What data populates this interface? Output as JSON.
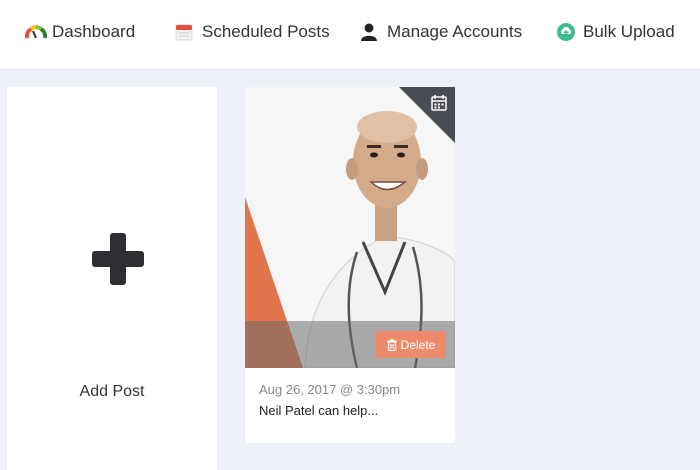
{
  "nav": {
    "items": [
      {
        "label": "Dashboard",
        "icon": "gauge-icon"
      },
      {
        "label": "Scheduled Posts",
        "icon": "calendar-icon"
      },
      {
        "label": "Manage Accounts",
        "icon": "user-icon"
      },
      {
        "label": "Bulk Upload",
        "icon": "cloud-upload-icon"
      }
    ]
  },
  "add_post": {
    "label": "Add Post",
    "icon": "plus-icon"
  },
  "posts": [
    {
      "date": "Aug 26, 2017 @ 3:30pm",
      "caption": "Neil Patel can help...",
      "delete_label": "Delete",
      "corner_icon": "calendar-icon",
      "image": "person-portrait"
    }
  ],
  "colors": {
    "accent": "#ee8a6c",
    "background": "#eef0f7",
    "bulk_upload_icon": "#3dbb8a",
    "corner": "#4a4d54"
  }
}
